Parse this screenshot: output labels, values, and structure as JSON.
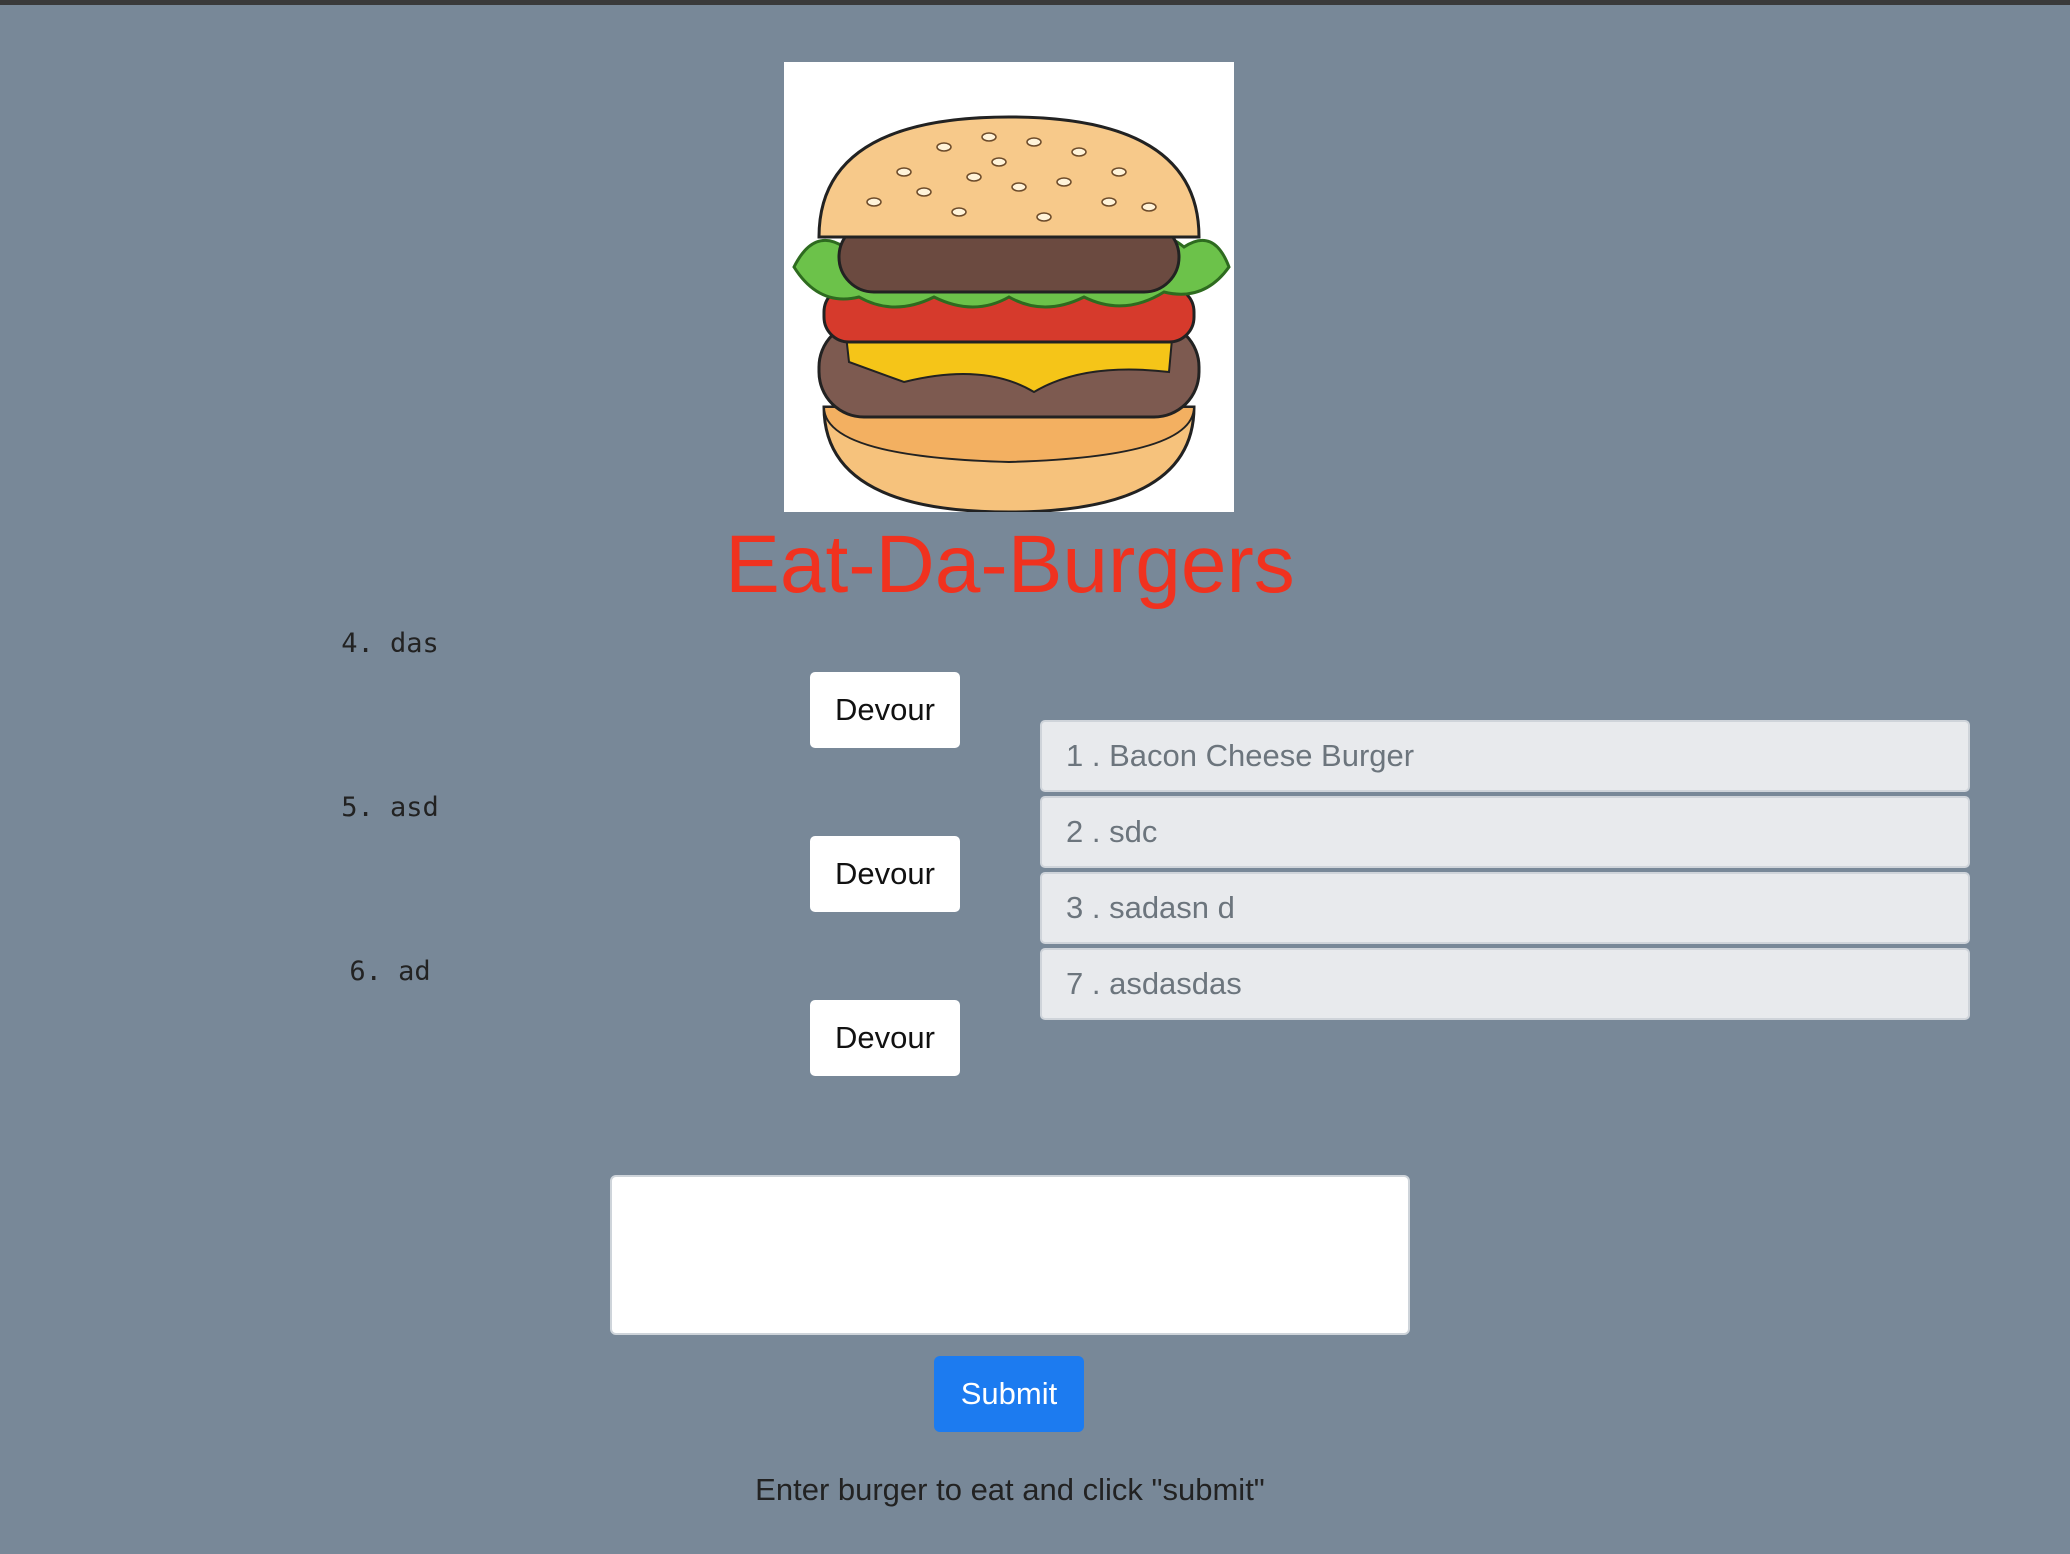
{
  "header": {
    "title": "Eat-Da-Burgers",
    "title_color": "#f0321f",
    "logo_icon": "hamburger-icon"
  },
  "uneaten": {
    "items": [
      {
        "label": "4. das",
        "button_label": "Devour"
      },
      {
        "label": "5. asd",
        "button_label": "Devour"
      },
      {
        "label": "6. ad",
        "button_label": "Devour"
      }
    ]
  },
  "devoured": {
    "items": [
      {
        "label": "1 . Bacon Cheese Burger"
      },
      {
        "label": "2 . sdc"
      },
      {
        "label": "3 . sadasn d"
      },
      {
        "label": "7 . asdasdas"
      }
    ]
  },
  "form": {
    "input_value": "",
    "input_placeholder": "",
    "submit_label": "Submit",
    "submit_color": "#1c7bf0",
    "instructions": "Enter burger to eat and click \"submit\""
  },
  "colors": {
    "background": "#788898",
    "devoured_item_bg": "#e8eaed"
  }
}
